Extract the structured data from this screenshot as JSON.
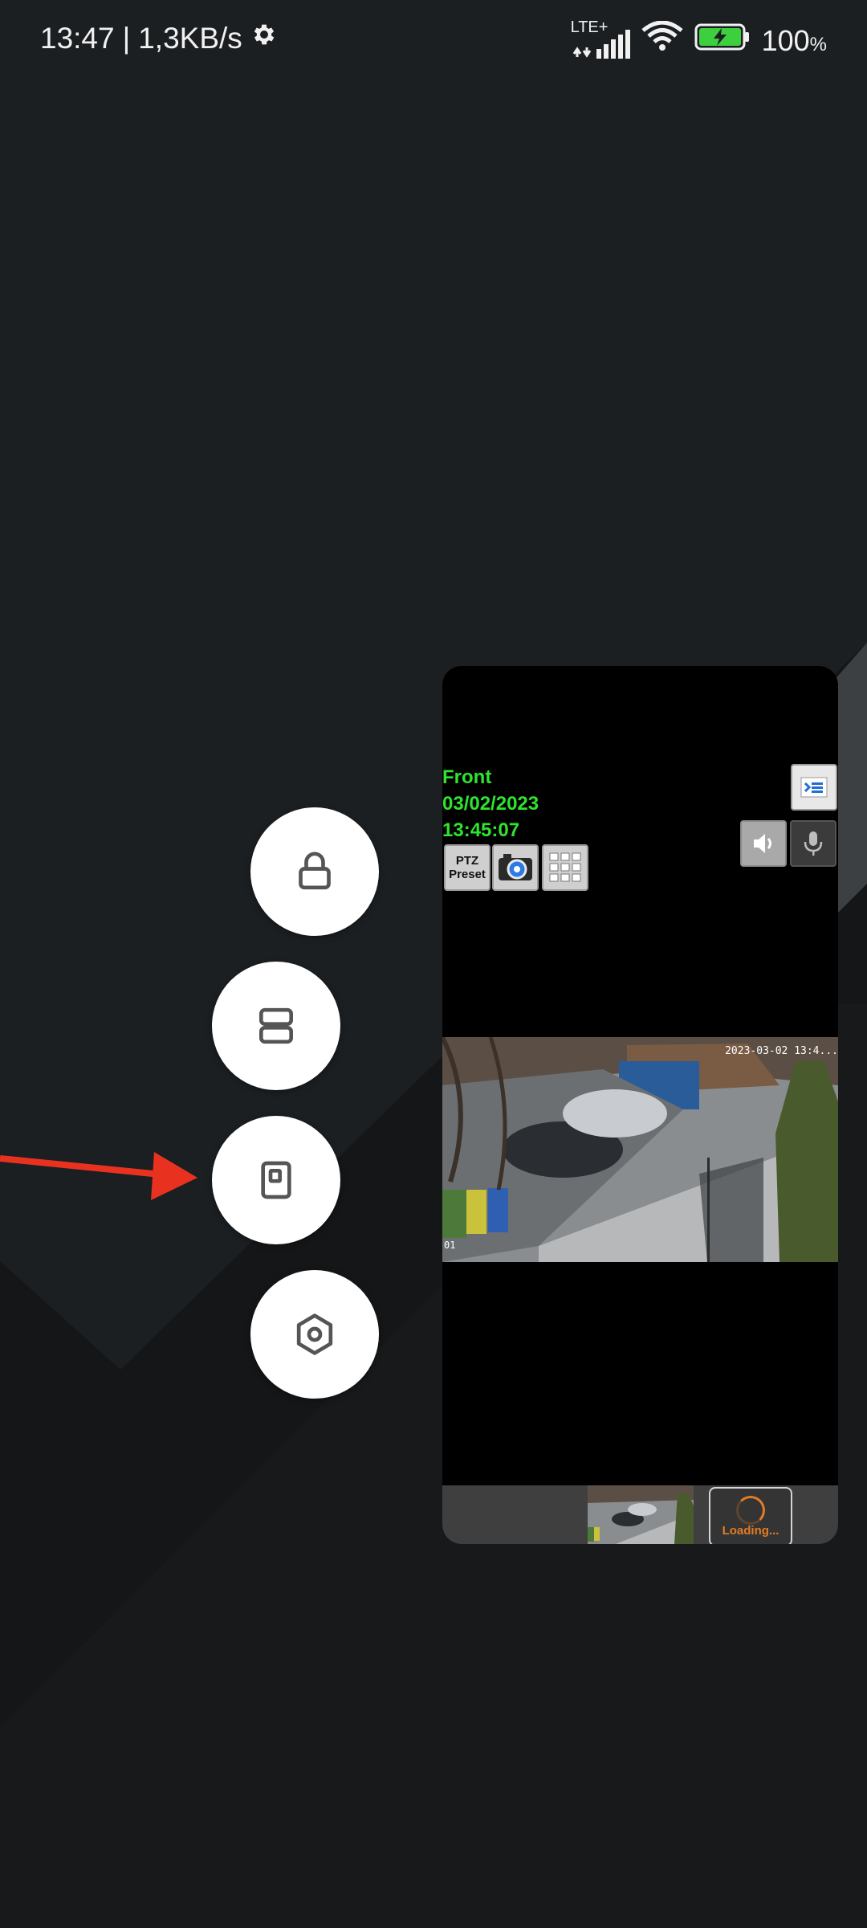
{
  "status_bar": {
    "time": "13:47",
    "separator": "|",
    "network_speed": "1,3KB/s",
    "network_type": "LTE+",
    "battery_level": "100",
    "battery_unit": "%",
    "icons": [
      "settings-gear-icon",
      "signal-icon",
      "wifi-icon",
      "battery-charging-icon"
    ]
  },
  "side_buttons": [
    {
      "name": "lock",
      "icon": "lock-icon"
    },
    {
      "name": "split-screen",
      "icon": "split-screen-icon"
    },
    {
      "name": "floating-window",
      "icon": "floating-window-icon"
    },
    {
      "name": "settings",
      "icon": "hexagon-settings-icon"
    }
  ],
  "floating_window": {
    "overlay": {
      "camera_name": "Front",
      "date": "03/02/2023",
      "time": "13:45:07"
    },
    "buttons": {
      "ptz_line1": "PTZ",
      "ptz_line2": "Preset"
    },
    "camera_feed": {
      "timestamp": "2023-03-02 13:4...",
      "channel": "01"
    },
    "bottom_bar": {
      "loading_label": "Loading..."
    }
  },
  "colors": {
    "overlay_text": "#2ee42e",
    "loading_accent": "#e27b25",
    "arrow": "#e8321f",
    "background": "#1b1f22"
  }
}
